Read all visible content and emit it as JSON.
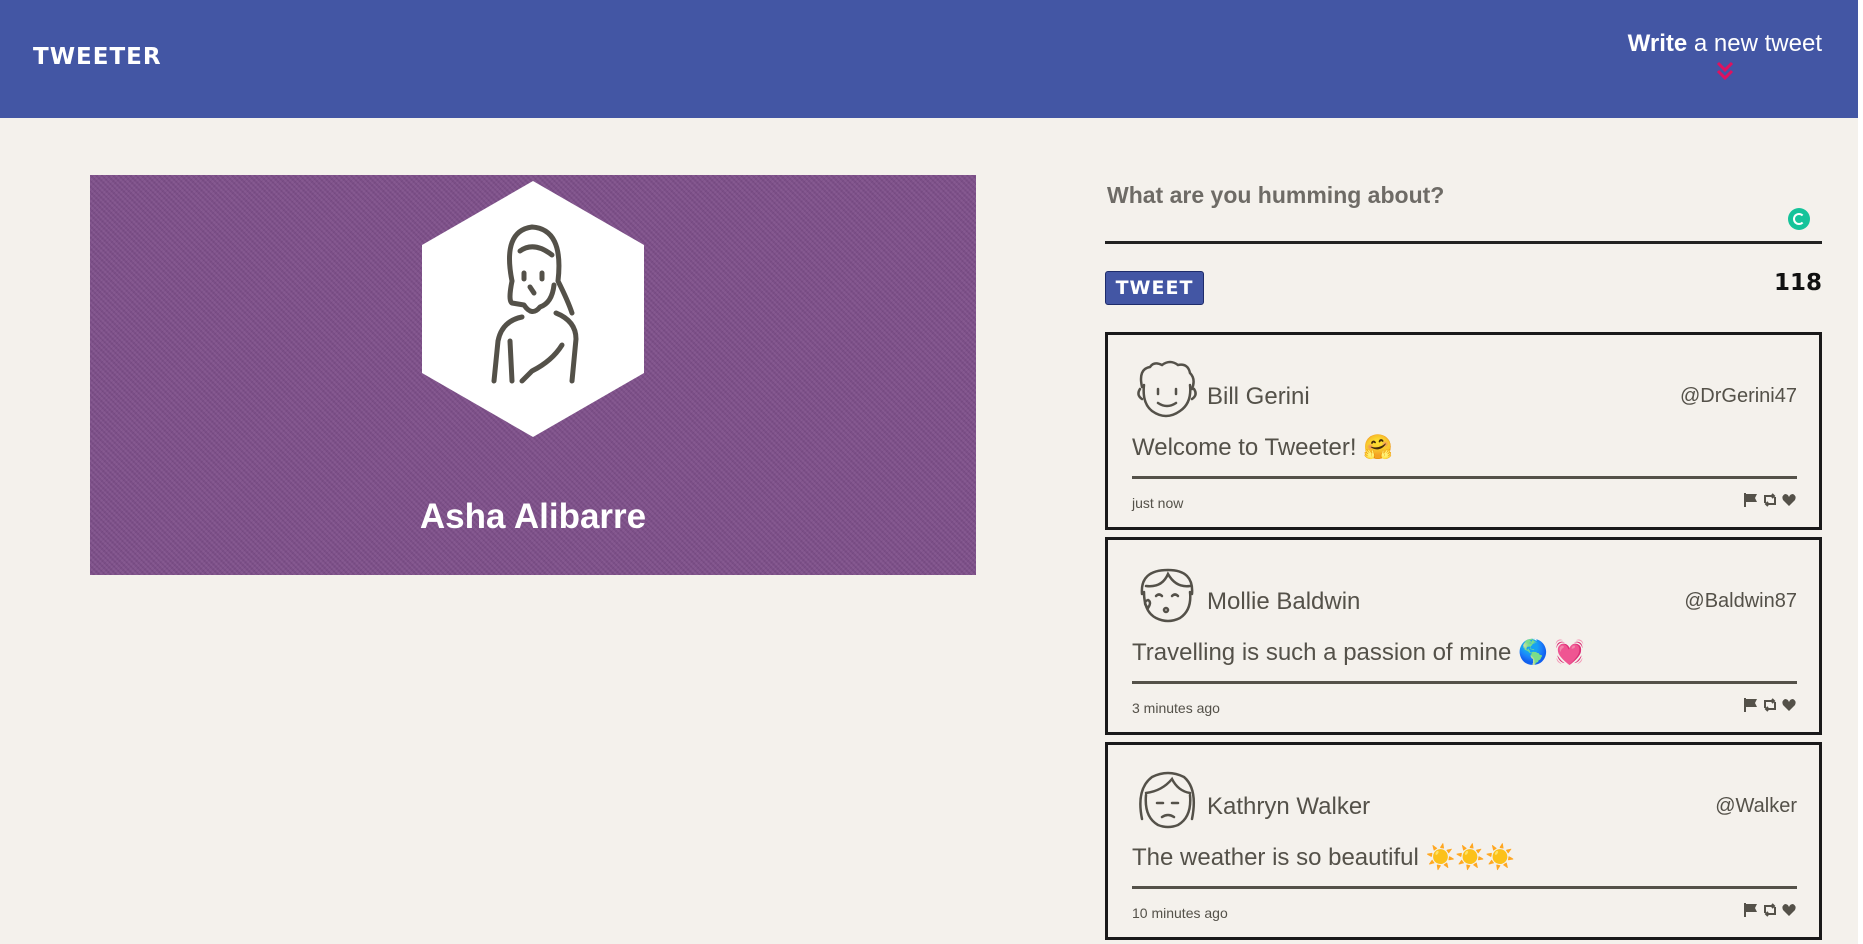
{
  "nav": {
    "brand": "TWEETER",
    "compose_bold": "Write",
    "compose_rest": " a new tweet",
    "accent": "#4356a4",
    "chevron_color": "#e0115f"
  },
  "profile": {
    "name": "Asha Alibarre",
    "background": "#7e4f8a"
  },
  "compose": {
    "placeholder": "What are you humming about?",
    "button_label": "TWEET",
    "counter": "118"
  },
  "tweets": [
    {
      "name": "Bill Gerini",
      "handle": "@DrGerini47",
      "body": "Welcome to Tweeter! 🤗",
      "time": "just now"
    },
    {
      "name": "Mollie Baldwin",
      "handle": "@Baldwin87",
      "body": "Travelling is such a passion of mine 🌎 💓",
      "time": "3 minutes ago"
    },
    {
      "name": "Kathryn Walker",
      "handle": "@Walker",
      "body": "The weather is so beautiful ☀️☀️☀️",
      "time": "10 minutes ago"
    }
  ],
  "icons": {
    "flag": "flag-icon",
    "retweet": "retweet-icon",
    "like": "heart-icon"
  }
}
